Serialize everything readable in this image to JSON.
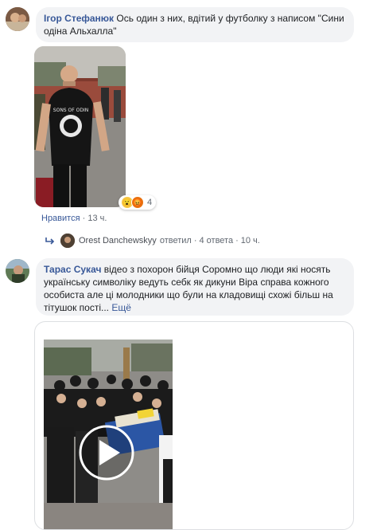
{
  "comment1": {
    "author": "Ігор Стефанюк",
    "text": "Ось один з них, вдітий у футболку з написом \"Сини одіна Альхалла\"",
    "reaction_count": "4",
    "like_label": "Нравится",
    "time": "13 ч.",
    "tshirt_text": "SONS OF ODIN"
  },
  "reply_summary": {
    "author": "Orest Danchewskyy",
    "action": "ответил",
    "replies": "4 ответа",
    "time": "10 ч."
  },
  "comment2": {
    "author": "Тарас Сукач",
    "text": "відео з похорон бійця Соромно що люди які носять українську символіку ведуть себк як дикуни Віра справа кожного особиста але ці молодники що були на кладовищі схожі більш на тітушок пості...",
    "more_label": "Ещё"
  },
  "icons": {
    "reply_arrow": "reply-arrow-icon",
    "play": "play-icon"
  },
  "colors": {
    "link": "#385898",
    "bubble": "#f2f3f5",
    "meta": "#606770"
  }
}
